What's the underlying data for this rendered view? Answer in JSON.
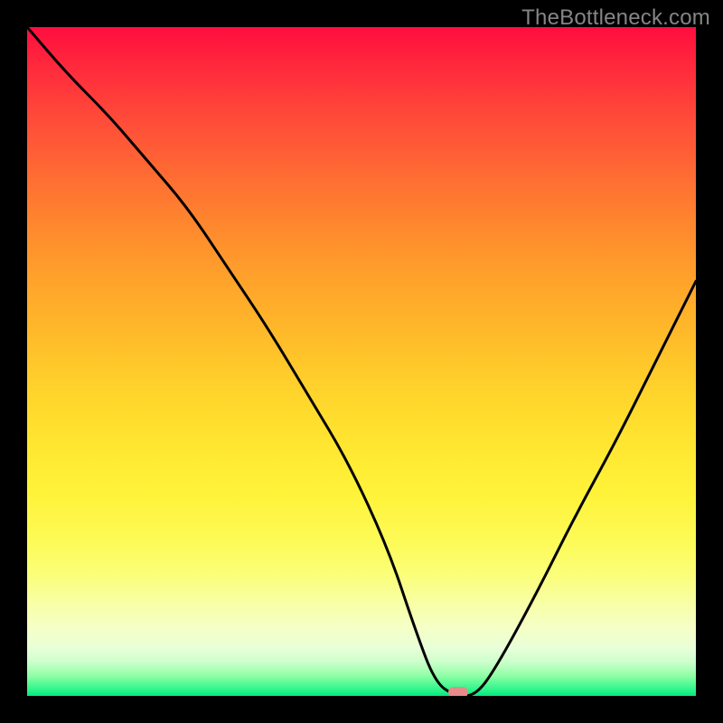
{
  "attribution": "TheBottleneck.com",
  "marker": {
    "x_pct": 64.5,
    "y_pct": 99.5,
    "color": "#e88a8a"
  },
  "chart_data": {
    "type": "line",
    "title": "",
    "xlabel": "",
    "ylabel": "",
    "xlim": [
      0,
      100
    ],
    "ylim": [
      0,
      100
    ],
    "grid": false,
    "legend": false,
    "background": "vertical-gradient red→green",
    "series": [
      {
        "name": "bottleneck-curve",
        "x": [
          0,
          6,
          12,
          18,
          24,
          30,
          36,
          42,
          48,
          54,
          58,
          61,
          64,
          67,
          70,
          76,
          82,
          88,
          94,
          100
        ],
        "y": [
          100,
          93,
          87,
          80,
          73,
          64,
          55,
          45,
          35,
          22,
          10,
          2,
          0,
          0,
          4,
          15,
          27,
          38,
          50,
          62
        ]
      }
    ],
    "annotations": [
      {
        "type": "marker",
        "x": 64.5,
        "y": 0,
        "shape": "pill",
        "color": "#e88a8a"
      }
    ]
  }
}
